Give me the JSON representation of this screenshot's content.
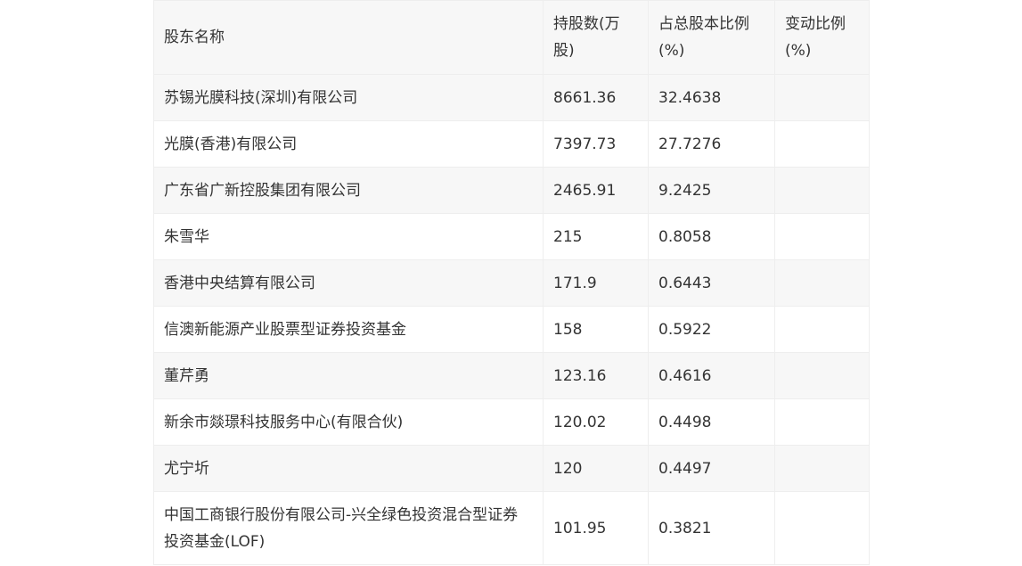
{
  "table": {
    "headers": {
      "name": "股东名称",
      "shares": "持股数(万股)",
      "ratio": "占总股本比例(%)",
      "change": "变动比例(%)"
    },
    "rows": [
      {
        "name": "苏锡光膜科技(深圳)有限公司",
        "shares": "8661.36",
        "ratio": "32.4638",
        "change": ""
      },
      {
        "name": "光膜(香港)有限公司",
        "shares": "7397.73",
        "ratio": "27.7276",
        "change": ""
      },
      {
        "name": "广东省广新控股集团有限公司",
        "shares": "2465.91",
        "ratio": "9.2425",
        "change": ""
      },
      {
        "name": "朱雪华",
        "shares": "215",
        "ratio": "0.8058",
        "change": ""
      },
      {
        "name": "香港中央结算有限公司",
        "shares": "171.9",
        "ratio": "0.6443",
        "change": ""
      },
      {
        "name": "信澳新能源产业股票型证券投资基金",
        "shares": "158",
        "ratio": "0.5922",
        "change": ""
      },
      {
        "name": "董芹勇",
        "shares": "123.16",
        "ratio": "0.4616",
        "change": ""
      },
      {
        "name": "新余市燚璟科技服务中心(有限合伙)",
        "shares": "120.02",
        "ratio": "0.4498",
        "change": ""
      },
      {
        "name": "尤宁圻",
        "shares": "120",
        "ratio": "0.4497",
        "change": ""
      },
      {
        "name": "中国工商银行股份有限公司-兴全绿色投资混合型证券投资基金(LOF)",
        "shares": "101.95",
        "ratio": "0.3821",
        "change": ""
      }
    ]
  }
}
